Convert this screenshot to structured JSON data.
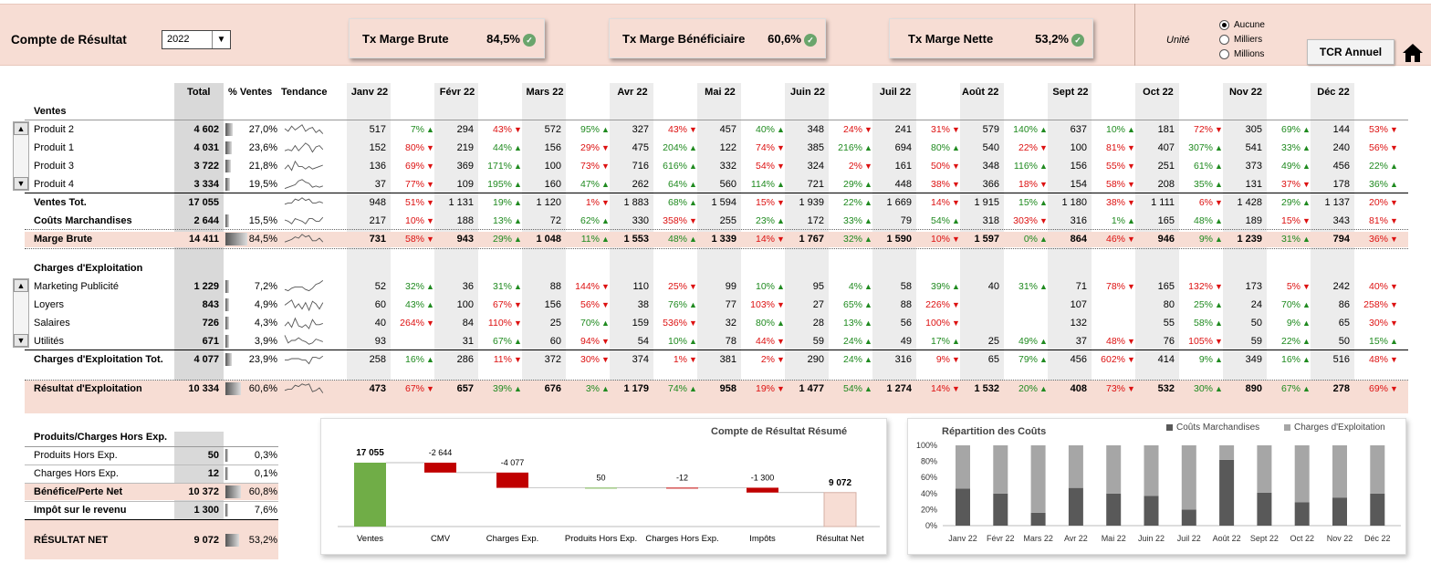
{
  "header": {
    "title": "Compte de Résultat",
    "year": "2022",
    "kpis": [
      {
        "label": "Tx Marge Brute",
        "value": "84,5%"
      },
      {
        "label": "Tx Marge Bénéficiaire",
        "value": "60,6%"
      },
      {
        "label": "Tx Marge Nette",
        "value": "53,2%"
      }
    ],
    "unit_label": "Unité",
    "unit_options": [
      "Aucune",
      "Milliers",
      "Millions"
    ],
    "unit_selected": "Aucune",
    "tcr_button": "TCR Annuel"
  },
  "columns": {
    "total": "Total",
    "pct_ventes": "% Ventes",
    "tendance": "Tendance",
    "months": [
      "Janv 22",
      "Févr 22",
      "Mars 22",
      "Avr 22",
      "Mai 22",
      "Juin 22",
      "Juil 22",
      "Août 22",
      "Sept 22",
      "Oct 22",
      "Nov 22",
      "Déc 22"
    ]
  },
  "sections": {
    "ventes": "Ventes",
    "charges": "Charges d'Exploitation",
    "hors": "Produits/Charges Hors Exp."
  },
  "rows": [
    {
      "label": "Produit 2",
      "total": "4 602",
      "pct": "27,0%",
      "pctv": 0.27,
      "vals": [
        "517",
        "294",
        "572",
        "327",
        "457",
        "348",
        "241",
        "579",
        "637",
        "181",
        "305",
        "144"
      ],
      "ch": [
        "7%",
        "43%",
        "95%",
        "43%",
        "40%",
        "24%",
        "31%",
        "140%",
        "10%",
        "72%",
        "69%",
        "53%"
      ],
      "dir": [
        "u",
        "d",
        "u",
        "d",
        "u",
        "d",
        "d",
        "u",
        "u",
        "d",
        "u",
        "d"
      ]
    },
    {
      "label": "Produit 1",
      "total": "4 031",
      "pct": "23,6%",
      "pctv": 0.236,
      "vals": [
        "152",
        "219",
        "156",
        "475",
        "122",
        "385",
        "694",
        "540",
        "100",
        "407",
        "541",
        "240"
      ],
      "ch": [
        "80%",
        "44%",
        "29%",
        "204%",
        "74%",
        "216%",
        "80%",
        "22%",
        "81%",
        "307%",
        "33%",
        "56%"
      ],
      "dir": [
        "d",
        "u",
        "d",
        "u",
        "d",
        "u",
        "u",
        "d",
        "d",
        "u",
        "u",
        "d"
      ]
    },
    {
      "label": "Produit 3",
      "total": "3 722",
      "pct": "21,8%",
      "pctv": 0.218,
      "vals": [
        "136",
        "369",
        "100",
        "716",
        "332",
        "324",
        "161",
        "348",
        "156",
        "251",
        "373",
        "456"
      ],
      "ch": [
        "69%",
        "171%",
        "73%",
        "616%",
        "54%",
        "2%",
        "50%",
        "116%",
        "55%",
        "61%",
        "49%",
        "22%"
      ],
      "dir": [
        "d",
        "u",
        "d",
        "u",
        "d",
        "d",
        "d",
        "u",
        "d",
        "u",
        "u",
        "u"
      ]
    },
    {
      "label": "Produit 4",
      "total": "3 334",
      "pct": "19,5%",
      "pctv": 0.195,
      "vals": [
        "37",
        "109",
        "160",
        "262",
        "560",
        "721",
        "448",
        "366",
        "154",
        "208",
        "131",
        "178"
      ],
      "ch": [
        "77%",
        "195%",
        "47%",
        "64%",
        "114%",
        "29%",
        "38%",
        "18%",
        "58%",
        "35%",
        "37%",
        "36%"
      ],
      "dir": [
        "d",
        "u",
        "u",
        "u",
        "u",
        "u",
        "d",
        "d",
        "d",
        "u",
        "d",
        "u"
      ]
    },
    {
      "label": "Ventes Tot.",
      "total": "17 055",
      "pct": "",
      "pctv": 0,
      "vals": [
        "948",
        "1 131",
        "1 120",
        "1 883",
        "1 594",
        "1 939",
        "1 669",
        "1 915",
        "1 180",
        "1 111",
        "1 428",
        "1 137"
      ],
      "ch": [
        "51%",
        "19%",
        "1%",
        "68%",
        "15%",
        "22%",
        "14%",
        "15%",
        "38%",
        "6%",
        "29%",
        "20%"
      ],
      "dir": [
        "d",
        "u",
        "d",
        "u",
        "d",
        "u",
        "d",
        "u",
        "d",
        "d",
        "u",
        "d"
      ]
    },
    {
      "label": "Coûts Marchandises",
      "total": "2 644",
      "pct": "15,5%",
      "pctv": 0.155,
      "vals": [
        "217",
        "188",
        "72",
        "330",
        "255",
        "172",
        "79",
        "318",
        "316",
        "165",
        "189",
        "343"
      ],
      "ch": [
        "10%",
        "13%",
        "62%",
        "358%",
        "23%",
        "33%",
        "54%",
        "303%",
        "1%",
        "48%",
        "15%",
        "81%"
      ],
      "dir": [
        "d",
        "u",
        "u",
        "d",
        "u",
        "u",
        "u",
        "d",
        "u",
        "u",
        "d",
        "d"
      ]
    },
    {
      "label": "Marge Brute",
      "total": "14 411",
      "pct": "84,5%",
      "pctv": 0.845,
      "vals": [
        "731",
        "943",
        "1 048",
        "1 553",
        "1 339",
        "1 767",
        "1 590",
        "1 597",
        "864",
        "946",
        "1 239",
        "794"
      ],
      "ch": [
        "58%",
        "29%",
        "11%",
        "48%",
        "14%",
        "32%",
        "10%",
        "0%",
        "46%",
        "9%",
        "31%",
        "36%"
      ],
      "dir": [
        "d",
        "u",
        "u",
        "u",
        "d",
        "u",
        "d",
        "u",
        "d",
        "u",
        "u",
        "d"
      ]
    },
    {
      "label": "Marketing Publicité",
      "total": "1 229",
      "pct": "7,2%",
      "pctv": 0.072,
      "vals": [
        "52",
        "36",
        "88",
        "110",
        "99",
        "95",
        "58",
        "40",
        "71",
        "165",
        "173",
        "242"
      ],
      "ch": [
        "32%",
        "31%",
        "144%",
        "25%",
        "10%",
        "4%",
        "39%",
        "31%",
        "78%",
        "132%",
        "5%",
        "40%"
      ],
      "dir": [
        "u",
        "u",
        "d",
        "d",
        "u",
        "u",
        "u",
        "u",
        "d",
        "d",
        "d",
        "d"
      ]
    },
    {
      "label": "Loyers",
      "total": "843",
      "pct": "4,9%",
      "pctv": 0.049,
      "vals": [
        "60",
        "100",
        "156",
        "38",
        "77",
        "27",
        "88",
        "",
        "107",
        "80",
        "24",
        "86"
      ],
      "ch": [
        "43%",
        "67%",
        "56%",
        "76%",
        "103%",
        "65%",
        "226%",
        "",
        "",
        "25%",
        "70%",
        "258%"
      ],
      "dir": [
        "u",
        "d",
        "d",
        "u",
        "d",
        "u",
        "d",
        "",
        "",
        "u",
        "u",
        "d"
      ]
    },
    {
      "label": "Salaires",
      "total": "726",
      "pct": "4,3%",
      "pctv": 0.043,
      "vals": [
        "40",
        "84",
        "25",
        "159",
        "32",
        "28",
        "56",
        "",
        "132",
        "55",
        "50",
        "65"
      ],
      "ch": [
        "264%",
        "110%",
        "70%",
        "536%",
        "80%",
        "13%",
        "100%",
        "",
        "",
        "58%",
        "9%",
        "30%"
      ],
      "dir": [
        "d",
        "d",
        "u",
        "d",
        "u",
        "u",
        "d",
        "",
        "",
        "u",
        "u",
        "d"
      ]
    },
    {
      "label": "Utilités",
      "total": "671",
      "pct": "3,9%",
      "pctv": 0.039,
      "vals": [
        "93",
        "31",
        "60",
        "54",
        "78",
        "59",
        "49",
        "25",
        "37",
        "76",
        "59",
        "50"
      ],
      "ch": [
        "",
        "67%",
        "94%",
        "10%",
        "44%",
        "24%",
        "17%",
        "49%",
        "48%",
        "105%",
        "22%",
        "15%"
      ],
      "dir": [
        "",
        "u",
        "d",
        "u",
        "d",
        "u",
        "u",
        "u",
        "d",
        "d",
        "u",
        "u"
      ]
    },
    {
      "label": "Charges d'Exploitation Tot.",
      "total": "4 077",
      "pct": "23,9%",
      "pctv": 0.239,
      "vals": [
        "258",
        "286",
        "372",
        "374",
        "381",
        "290",
        "316",
        "65",
        "456",
        "414",
        "349",
        "516"
      ],
      "ch": [
        "16%",
        "11%",
        "30%",
        "1%",
        "2%",
        "24%",
        "9%",
        "79%",
        "602%",
        "9%",
        "16%",
        "48%"
      ],
      "dir": [
        "u",
        "d",
        "d",
        "d",
        "d",
        "u",
        "d",
        "u",
        "d",
        "u",
        "u",
        "d"
      ]
    },
    {
      "label": "Résultat d'Exploitation",
      "total": "10 334",
      "pct": "60,6%",
      "pctv": 0.606,
      "vals": [
        "473",
        "657",
        "676",
        "1 179",
        "958",
        "1 477",
        "1 274",
        "1 532",
        "408",
        "532",
        "890",
        "278"
      ],
      "ch": [
        "67%",
        "39%",
        "3%",
        "74%",
        "19%",
        "54%",
        "14%",
        "20%",
        "73%",
        "30%",
        "67%",
        "69%"
      ],
      "dir": [
        "d",
        "u",
        "u",
        "u",
        "d",
        "u",
        "d",
        "u",
        "d",
        "u",
        "u",
        "d"
      ]
    }
  ],
  "hors": [
    {
      "label": "Produits Hors Exp.",
      "total": "50",
      "pct": "0,3%",
      "pctv": 0.003
    },
    {
      "label": "Charges Hors Exp.",
      "total": "12",
      "pct": "0,1%",
      "pctv": 0.001
    },
    {
      "label": "Bénéfice/Perte Net",
      "total": "10 372",
      "pct": "60,8%",
      "pctv": 0.608
    },
    {
      "label": "Impôt sur le revenu",
      "total": "1 300",
      "pct": "7,6%",
      "pctv": 0.076
    },
    {
      "label": "RÉSULTAT NET",
      "total": "9 072",
      "pct": "53,2%",
      "pctv": 0.532
    }
  ],
  "chart_data": [
    {
      "type": "bar",
      "subtype": "waterfall",
      "title": "Compte de Résultat Résumé",
      "categories": [
        "Ventes",
        "CMV",
        "Charges Exp.",
        "Produits Hors Exp.",
        "Charges Hors Exp.",
        "Impôts",
        "Résultat Net"
      ],
      "values": [
        17055,
        -2644,
        -4077,
        50,
        -12,
        -1300,
        9072
      ],
      "labels": [
        "17 055",
        "-2 644",
        "-4 077",
        "50",
        "-12",
        "-1 300",
        "9 072"
      ],
      "colors": {
        "total_start": "#70ad47",
        "negative": "#c00000",
        "positive": "#70ad47",
        "total_end": "#f7ddd4"
      }
    },
    {
      "type": "bar",
      "subtype": "stacked-percent",
      "title": "Répartition des Coûts",
      "categories": [
        "Janv 22",
        "Févr 22",
        "Mars 22",
        "Avr 22",
        "Mai 22",
        "Juin 22",
        "Juil 22",
        "Août 22",
        "Sept 22",
        "Oct 22",
        "Nov 22",
        "Déc 22"
      ],
      "series": [
        {
          "name": "Coûts Marchandises",
          "color": "#595959",
          "values": [
            46,
            40,
            16,
            47,
            40,
            37,
            20,
            82,
            41,
            29,
            35,
            40
          ]
        },
        {
          "name": "Charges d'Exploitation",
          "color": "#a6a6a6",
          "values": [
            54,
            60,
            84,
            53,
            60,
            63,
            80,
            18,
            59,
            71,
            65,
            60
          ]
        }
      ],
      "yticks": [
        "0%",
        "20%",
        "40%",
        "60%",
        "80%",
        "100%"
      ],
      "ylim": [
        0,
        100
      ],
      "legend": "top-right"
    }
  ]
}
